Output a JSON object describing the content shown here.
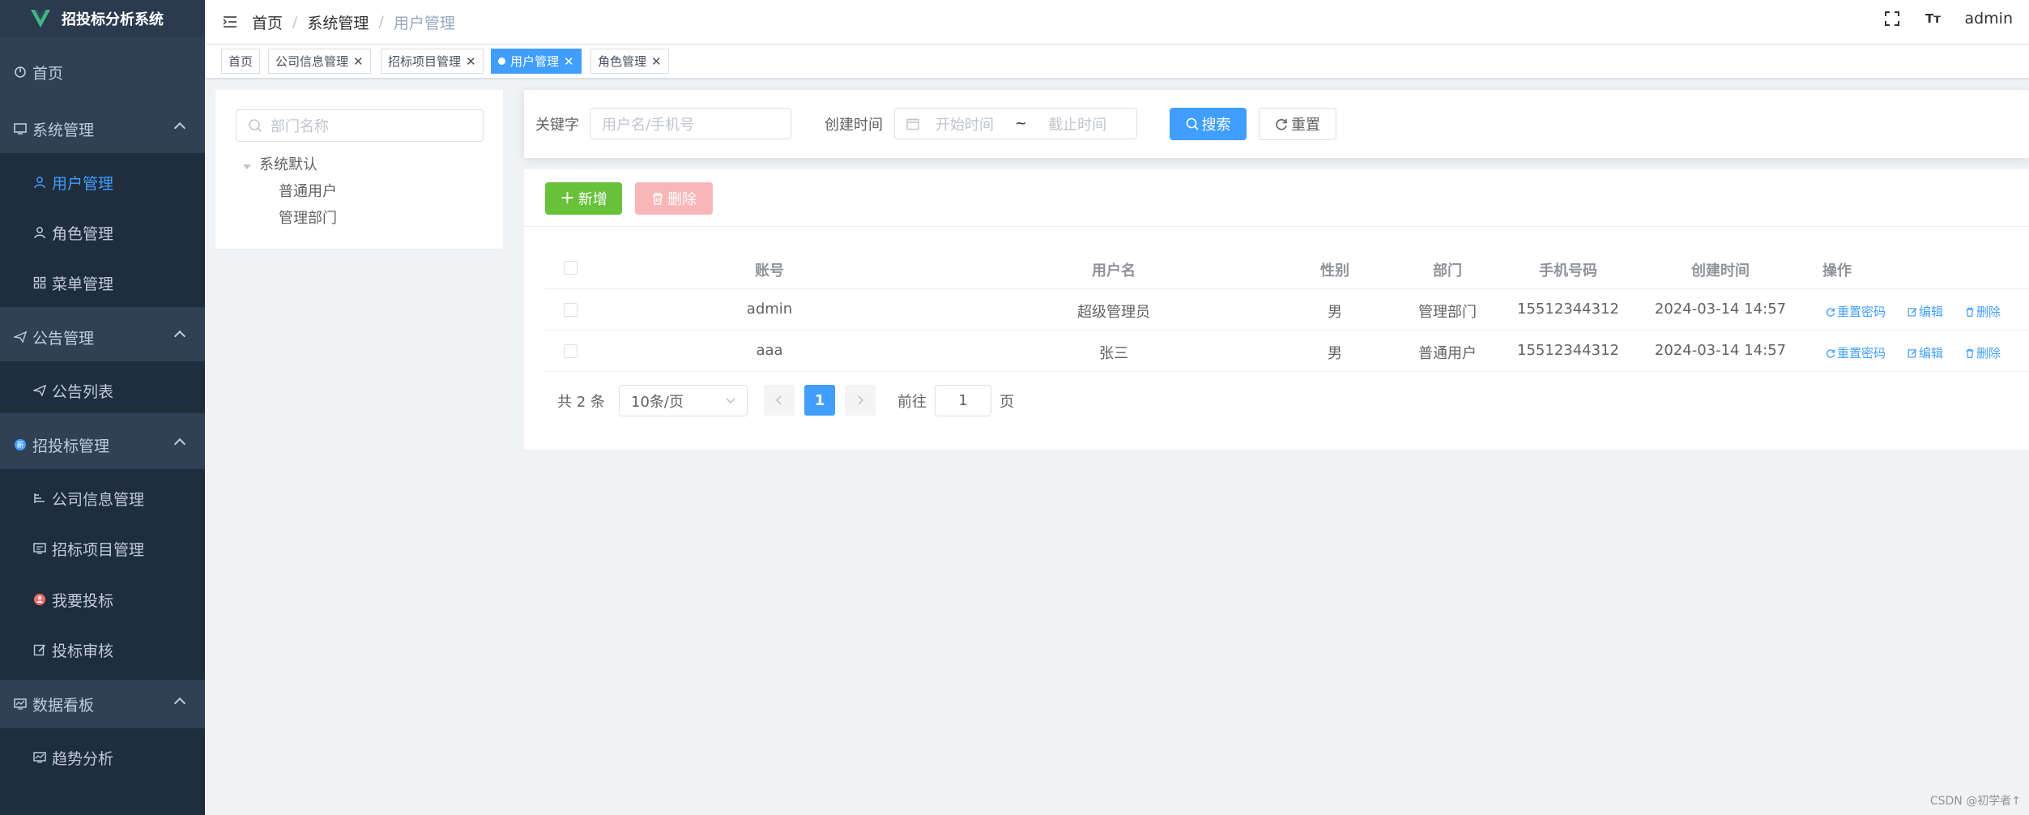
{
  "app": {
    "title": "招投标分析系统"
  },
  "sidebar": {
    "home": "首页",
    "system": "系统管理",
    "user_mgmt": "用户管理",
    "role_mgmt": "角色管理",
    "menu_mgmt": "菜单管理",
    "notice": "公告管理",
    "notice_list": "公告列表",
    "bidding": "招投标管理",
    "company_info": "公司信息管理",
    "bid_project": "招标项目管理",
    "my_bid": "我要投标",
    "bid_review": "投标审核",
    "dashboard": "数据看板",
    "trend": "趋势分析"
  },
  "navbar": {
    "breadcrumb": [
      "首页",
      "系统管理",
      "用户管理"
    ],
    "font_icon": "Tт",
    "user": "admin"
  },
  "tags": [
    {
      "label": "首页",
      "closable": false
    },
    {
      "label": "公司信息管理",
      "closable": true
    },
    {
      "label": "招标项目管理",
      "closable": true
    },
    {
      "label": "用户管理",
      "closable": true,
      "active": true
    },
    {
      "label": "角色管理",
      "closable": true
    }
  ],
  "tree": {
    "search_placeholder": "部门名称",
    "root": "系统默认",
    "children": [
      "普通用户",
      "管理部门"
    ]
  },
  "search": {
    "keyword_label": "关键字",
    "keyword_placeholder": "用户名/手机号",
    "time_label": "创建时间",
    "start_placeholder": "开始时间",
    "range_sep": "~",
    "end_placeholder": "截止时间",
    "search_btn": "搜索",
    "reset_btn": "重置"
  },
  "toolbar": {
    "add_btn": "新增",
    "delete_btn": "删除"
  },
  "table": {
    "columns": [
      "账号",
      "用户名",
      "性别",
      "部门",
      "手机号码",
      "创建时间",
      "操作"
    ],
    "rows": [
      {
        "account": "admin",
        "username": "超级管理员",
        "gender": "男",
        "dept": "管理部门",
        "phone": "15512344312",
        "created": "2024-03-14 14:57"
      },
      {
        "account": "aaa",
        "username": "张三",
        "gender": "男",
        "dept": "普通用户",
        "phone": "15512344312",
        "created": "2024-03-14 14:57"
      }
    ],
    "ops": {
      "reset_pwd": "重置密码",
      "edit": "编辑",
      "delete": "删除"
    }
  },
  "pagination": {
    "total": "共 2 条",
    "page_size": "10条/页",
    "current": "1",
    "goto_label": "前往",
    "goto_value": "1",
    "page_unit": "页"
  },
  "watermark": "CSDN @初学者↑",
  "colors": {
    "sidebar": "#304156",
    "primary": "#409eff",
    "success": "#67c23a",
    "danger_disabled": "#fab6b6"
  }
}
